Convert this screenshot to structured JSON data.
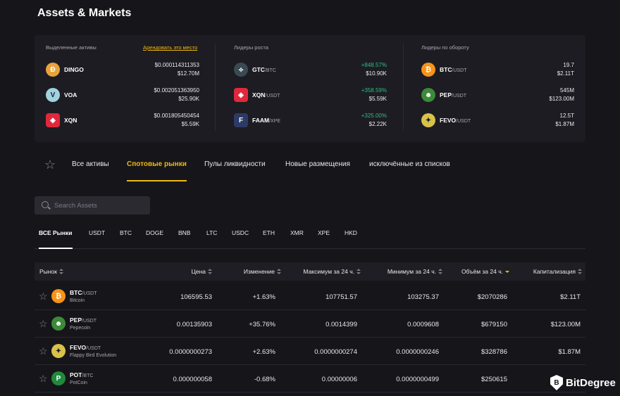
{
  "page_title": "Assets & Markets",
  "highlight": {
    "featured": {
      "heading": "Выделенные активы",
      "rent_link": "Арендовать это место",
      "items": [
        {
          "name": "DINGO",
          "price": "$0.000114311353",
          "volume": "$12.70M",
          "color": "#e8a33d",
          "icon": "dingo-coin-icon"
        },
        {
          "name": "VOA",
          "price": "$0.002051363950",
          "volume": "$25.90K",
          "color": "#9fd3df",
          "icon": "voa-coin-icon"
        },
        {
          "name": "XQN",
          "price": "$0.001805450454",
          "volume": "$5.59K",
          "color": "#e0283c",
          "icon": "xqn-coin-icon"
        }
      ]
    },
    "gainers": {
      "heading": "Лидеры роста",
      "items": [
        {
          "base": "GTC",
          "quote": "/BTC",
          "change": "+848.57%",
          "volume": "$10.90K",
          "color": "#3a4a52",
          "icon": "gtc-coin-icon"
        },
        {
          "base": "XQN",
          "quote": "/USDT",
          "change": "+358.59%",
          "volume": "$5.59K",
          "color": "#e0283c",
          "icon": "xqn-coin-icon"
        },
        {
          "base": "FAAM",
          "quote": "/XPE",
          "change": "+325.00%",
          "volume": "$2.22K",
          "color": "#2c3a66",
          "icon": "faam-coin-icon"
        }
      ]
    },
    "volume_leaders": {
      "heading": "Лидеры по обороту",
      "items": [
        {
          "base": "BTC",
          "quote": "/USDT",
          "value1": "19.7",
          "value2": "$2.11T",
          "color": "#f7931a",
          "icon": "bitcoin-coin-icon"
        },
        {
          "base": "PEP",
          "quote": "/USDT",
          "value1": "545M",
          "value2": "$123.00M",
          "color": "#3c8a3a",
          "icon": "pepecoin-icon"
        },
        {
          "base": "FEVO",
          "quote": "/USDT",
          "value1": "12.5T",
          "value2": "$1.87M",
          "color": "#d8c24a",
          "icon": "fevo-coin-icon"
        }
      ]
    }
  },
  "tabs": [
    "Все активы",
    "Спотовые рынки",
    "Пулы ликвидности",
    "Новые размещения",
    "исключённые из списков"
  ],
  "search": {
    "placeholder": "Search Assets"
  },
  "quote_tabs": [
    "ВСЕ Рынки",
    "USDT",
    "BTC",
    "DOGE",
    "BNB",
    "LTC",
    "USDC",
    "ETH",
    "XMR",
    "XPE",
    "HKD"
  ],
  "table": {
    "headers": [
      "Рынок",
      "Цена",
      "Изменение",
      "Максимум за 24 ч.",
      "Минимум за 24 ч.",
      "Объём за 24 ч.",
      "Капитализация"
    ],
    "rows": [
      {
        "base": "BTC",
        "quote": "/USDT",
        "name": "Bitcoin",
        "price": "106595.53",
        "price_dir": "red",
        "change": "+1.63%",
        "change_dir": "green",
        "high": "107751.57",
        "low": "103275.37",
        "volume": "$2070286",
        "cap": "$2.11T",
        "color": "#f7931a",
        "icon": "bitcoin-coin-icon"
      },
      {
        "base": "PEP",
        "quote": "/USDT",
        "name": "Pepecoin",
        "price": "0.00135903",
        "price_dir": "red",
        "change": "+35.76%",
        "change_dir": "green",
        "high": "0.0014399",
        "low": "0.0009608",
        "volume": "$679150",
        "cap": "$123.00M",
        "color": "#3c8a3a",
        "icon": "pepecoin-icon"
      },
      {
        "base": "FEVO",
        "quote": "/USDT",
        "name": "Flappy Bird Evolution",
        "price": "0.0000000273",
        "price_dir": "green",
        "change": "+2.63%",
        "change_dir": "green",
        "high": "0.0000000274",
        "low": "0.0000000246",
        "volume": "$328786",
        "cap": "$1.87M",
        "color": "#d8c24a",
        "icon": "fevo-coin-icon"
      },
      {
        "base": "POT",
        "quote": "/BTC",
        "name": "PotCoin",
        "price": "0.000000058",
        "price_dir": "green",
        "change": "-0.68%",
        "change_dir": "red",
        "high": "0.00000006",
        "low": "0.0000000499",
        "volume": "$250615",
        "cap": "",
        "color": "#1f8a3c",
        "icon": "potcoin-icon"
      }
    ]
  },
  "watermark": "BitDegree"
}
